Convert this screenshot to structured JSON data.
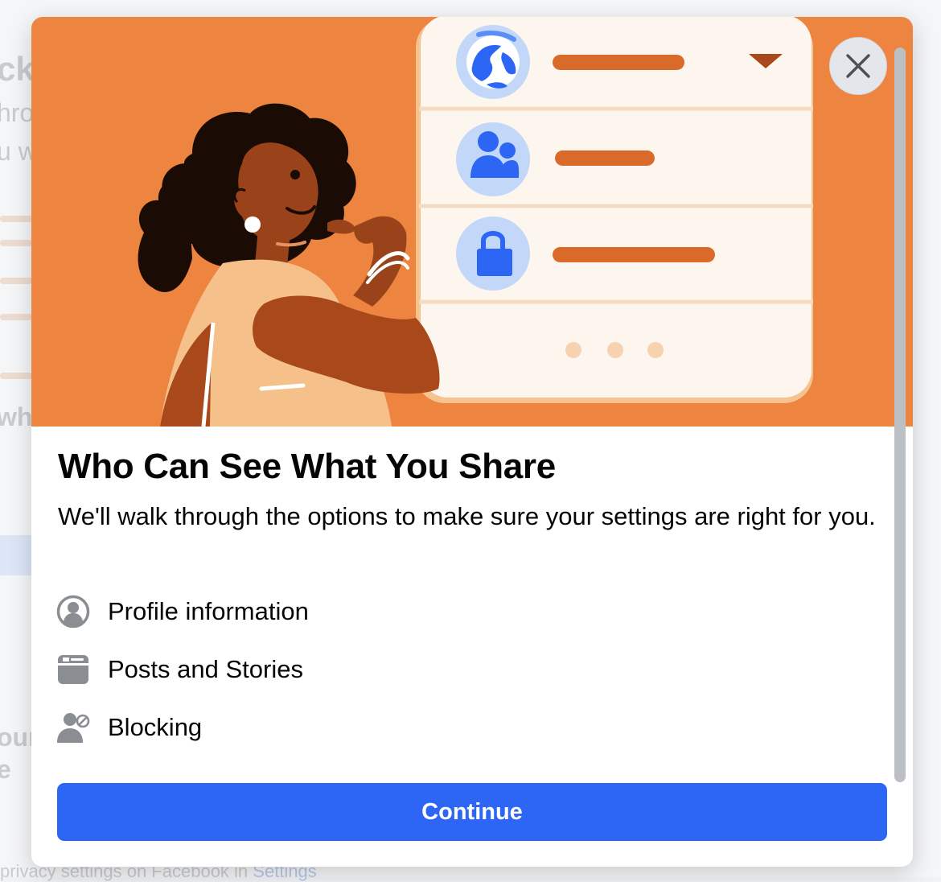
{
  "background": {
    "fragments": [
      "ck",
      "hro",
      "u w",
      "wha",
      "our",
      "e"
    ],
    "footer_text": "privacy settings on Facebook in",
    "footer_link": "Settings"
  },
  "modal": {
    "title": "Who Can See What You Share",
    "subtitle": "We'll walk through the options to make sure your settings are right for you.",
    "items": [
      {
        "label": "Profile information",
        "icon": "profile-icon"
      },
      {
        "label": "Posts and Stories",
        "icon": "posts-icon"
      },
      {
        "label": "Blocking",
        "icon": "blocking-icon"
      }
    ],
    "continue_label": "Continue",
    "close_icon": "close-icon"
  },
  "colors": {
    "hero_orange": "#ed843f",
    "primary_blue": "#2d66f5",
    "text_dark": "#050505",
    "icon_gray": "#8a8d91"
  }
}
